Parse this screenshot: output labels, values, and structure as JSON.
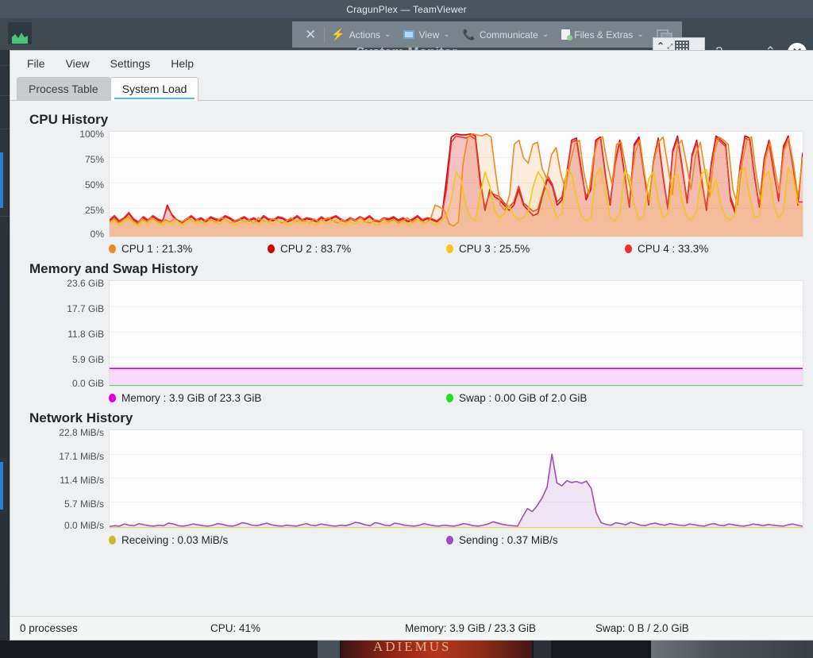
{
  "remote": {
    "title": "CragunPlex — TeamViewer",
    "app_icon": "chart-icon",
    "toolbar": {
      "close_label": "✕",
      "items": [
        {
          "label": "Actions",
          "icon": "lightning-icon",
          "caret": "⌄"
        },
        {
          "label": "View",
          "icon": "monitor-icon",
          "caret": "⌄"
        },
        {
          "label": "Communicate",
          "icon": "phone-icon",
          "caret": "⌄"
        },
        {
          "label": "Files & Extras",
          "icon": "file-icon",
          "caret": "⌄"
        }
      ],
      "windows_icon": "windows-switch-icon"
    },
    "overlay_window_title": "System Monitor",
    "popup": {
      "chevron": "⌃",
      "expand": "⤢",
      "grid": "keyboard-grid-icon"
    },
    "right_controls": [
      {
        "name": "help-button",
        "glyph": "?"
      },
      {
        "name": "minimize-button",
        "glyph": "⌄"
      },
      {
        "name": "maximize-button",
        "glyph": "⌃"
      }
    ],
    "close_glyph": "✕"
  },
  "app": {
    "menu": [
      {
        "label": "File"
      },
      {
        "label": "View"
      },
      {
        "label": "Settings"
      },
      {
        "label": "Help"
      }
    ],
    "tabs": [
      {
        "label": "Process Table",
        "active": false
      },
      {
        "label": "System Load",
        "active": true
      }
    ]
  },
  "sections": {
    "cpu": {
      "title": "CPU History",
      "y_ticks": [
        "100%",
        "75%",
        "50%",
        "25%",
        "0%"
      ],
      "legend": [
        {
          "label": "CPU 1 : 21.3%",
          "color": "#ef8a22"
        },
        {
          "label": "CPU 2 : 83.7%",
          "color": "#d40000"
        },
        {
          "label": "CPU 3 : 25.5%",
          "color": "#f5c518"
        },
        {
          "label": "CPU 4 : 33.3%",
          "color": "#e83030"
        }
      ]
    },
    "memory": {
      "title": "Memory and Swap History",
      "y_ticks": [
        "23.6 GiB",
        "17.7 GiB",
        "11.8 GiB",
        "5.9 GiB",
        "0.0 GiB"
      ],
      "legend": [
        {
          "label": "Memory : 3.9 GiB of 23.3 GiB",
          "color": "#dd00dd"
        },
        {
          "label": "Swap : 0.00 GiB of 2.0 GiB",
          "color": "#22dd22"
        }
      ]
    },
    "network": {
      "title": "Network History",
      "y_ticks": [
        "22.8 MiB/s",
        "17.1 MiB/s",
        "11.4 MiB/s",
        "5.7 MiB/s",
        "0.0 MiB/s"
      ],
      "legend": [
        {
          "label": "Receiving : 0.03 MiB/s",
          "color": "#c8b830"
        },
        {
          "label": "Sending : 0.37 MiB/s",
          "color": "#9b4fc0"
        }
      ]
    }
  },
  "statusbar": {
    "processes": "0 processes",
    "cpu": "CPU: 41%",
    "memory": "Memory: 3.9 GiB / 23.3 GiB",
    "swap": "Swap: 0 B / 2.0 GiB"
  },
  "desktop": {
    "poster_text": "ADIEMUS"
  },
  "chart_data": [
    {
      "type": "line",
      "title": "CPU History",
      "xlabel": "",
      "ylabel": "",
      "ylim": [
        0,
        100
      ],
      "ytick_values": [
        0,
        25,
        50,
        75,
        100
      ],
      "ytick_labels": [
        "0%",
        "25%",
        "50%",
        "75%",
        "100%"
      ],
      "grid": true,
      "legend_position": "below",
      "series": [
        {
          "name": "CPU 1",
          "color": "#ef8a22",
          "current": 21.3,
          "values": [
            14,
            17,
            13,
            16,
            19,
            15,
            12,
            17,
            14,
            18,
            15,
            13,
            16,
            14,
            17,
            13,
            15,
            18,
            14,
            16,
            13,
            17,
            15,
            14,
            18,
            16,
            13,
            15,
            17,
            14,
            16,
            13,
            18,
            15,
            14,
            17,
            16,
            13,
            15,
            18,
            14,
            16,
            15,
            13,
            17,
            14,
            16,
            18,
            15,
            13,
            16,
            14,
            17,
            15,
            18,
            14,
            13,
            16,
            15,
            17,
            14,
            16,
            13,
            15,
            18,
            14,
            16,
            15,
            13,
            17,
            30,
            28,
            25,
            12,
            10,
            14,
            70,
            95,
            98,
            97,
            96,
            98,
            95,
            60,
            30,
            25,
            40,
            88,
            92,
            75,
            70,
            88,
            90,
            65,
            55,
            78,
            85,
            60,
            45,
            70,
            88,
            92,
            60,
            40,
            75,
            92,
            95,
            70,
            50,
            88,
            90,
            65,
            45,
            80,
            92,
            60,
            35,
            72,
            90,
            95,
            68,
            40,
            85,
            92,
            70,
            45,
            78,
            90,
            62,
            38,
            80,
            95,
            92,
            88,
            45,
            30,
            70,
            92,
            95,
            60,
            35,
            75,
            90,
            65,
            42,
            82,
            94,
            70,
            38,
            76
          ]
        },
        {
          "name": "CPU 2",
          "color": "#d40000",
          "current": 83.7,
          "values": [
            15,
            19,
            14,
            17,
            22,
            16,
            13,
            18,
            15,
            19,
            16,
            14,
            30,
            20,
            15,
            13,
            16,
            19,
            15,
            17,
            14,
            18,
            16,
            15,
            19,
            17,
            14,
            16,
            18,
            15,
            17,
            14,
            19,
            16,
            15,
            18,
            17,
            14,
            16,
            19,
            15,
            17,
            16,
            14,
            18,
            15,
            17,
            19,
            16,
            14,
            17,
            15,
            18,
            16,
            19,
            15,
            14,
            17,
            16,
            18,
            15,
            17,
            14,
            16,
            19,
            15,
            17,
            16,
            14,
            18,
            55,
            95,
            98,
            97,
            97,
            98,
            96,
            55,
            25,
            45,
            38,
            35,
            30,
            25,
            30,
            45,
            30,
            25,
            20,
            22,
            40,
            55,
            48,
            30,
            35,
            60,
            92,
            94,
            65,
            35,
            45,
            92,
            95,
            60,
            30,
            70,
            92,
            60,
            28,
            88,
            95,
            62,
            30,
            72,
            94,
            58,
            26,
            82,
            96,
            66,
            32,
            78,
            92,
            55,
            25,
            70,
            96,
            92,
            88,
            35,
            22,
            68,
            96,
            94,
            58,
            28,
            74,
            92,
            62,
            34,
            86,
            96,
            68,
            30,
            80
          ]
        },
        {
          "name": "CPU 3",
          "color": "#f5c518",
          "current": 25.5,
          "values": [
            12,
            15,
            11,
            14,
            17,
            13,
            10,
            15,
            12,
            16,
            13,
            11,
            14,
            12,
            15,
            11,
            13,
            16,
            12,
            14,
            11,
            15,
            13,
            12,
            16,
            14,
            11,
            13,
            15,
            12,
            14,
            11,
            16,
            13,
            12,
            15,
            14,
            11,
            13,
            16,
            12,
            14,
            13,
            11,
            15,
            12,
            14,
            16,
            13,
            11,
            14,
            12,
            15,
            13,
            16,
            12,
            11,
            14,
            13,
            15,
            12,
            14,
            11,
            13,
            16,
            12,
            14,
            13,
            11,
            15,
            20,
            35,
            62,
            55,
            30,
            18,
            15,
            40,
            62,
            48,
            25,
            18,
            22,
            30,
            20,
            16,
            18,
            25,
            48,
            62,
            55,
            42,
            30,
            18,
            22,
            64,
            60,
            38,
            20,
            15,
            18,
            58,
            66,
            42,
            18,
            15,
            22,
            62,
            58,
            30,
            16,
            20,
            55,
            62,
            35,
            18,
            22,
            56,
            60,
            32,
            18,
            16,
            25,
            60,
            64,
            40,
            55,
            30,
            18,
            16,
            22,
            62,
            66,
            38,
            18,
            20,
            58,
            62,
            30,
            18,
            24,
            66,
            58,
            32,
            26
          ]
        },
        {
          "name": "CPU 4",
          "color": "#e83030",
          "current": 33.3,
          "values": [
            16,
            20,
            15,
            18,
            23,
            17,
            14,
            19,
            16,
            20,
            17,
            15,
            28,
            21,
            16,
            14,
            17,
            20,
            16,
            18,
            15,
            19,
            17,
            16,
            20,
            18,
            15,
            17,
            19,
            16,
            18,
            15,
            20,
            17,
            16,
            19,
            18,
            15,
            17,
            20,
            16,
            18,
            17,
            15,
            19,
            16,
            18,
            20,
            17,
            15,
            18,
            16,
            19,
            17,
            20,
            16,
            15,
            18,
            17,
            19,
            16,
            18,
            15,
            17,
            20,
            16,
            18,
            17,
            15,
            19,
            45,
            90,
            96,
            95,
            94,
            96,
            93,
            50,
            28,
            42,
            40,
            38,
            32,
            28,
            33,
            48,
            32,
            28,
            24,
            26,
            42,
            58,
            50,
            33,
            38,
            62,
            90,
            92,
            62,
            38,
            48,
            90,
            94,
            58,
            32,
            68,
            90,
            58,
            30,
            86,
            93,
            60,
            32,
            70,
            92,
            56,
            28,
            80,
            94,
            64,
            34,
            76,
            90,
            52,
            28,
            68,
            94,
            90,
            86,
            38,
            25,
            66,
            94,
            92,
            56,
            30,
            72,
            90,
            60,
            36,
            84,
            94,
            66,
            33,
            33
          ]
        }
      ]
    },
    {
      "type": "line",
      "title": "Memory and Swap History",
      "xlabel": "",
      "ylabel": "",
      "ylim": [
        0,
        23.6
      ],
      "ytick_values": [
        0.0,
        5.9,
        11.8,
        17.7,
        23.6
      ],
      "ytick_labels": [
        "0.0 GiB",
        "5.9 GiB",
        "11.8 GiB",
        "17.7 GiB",
        "23.6 GiB"
      ],
      "grid": true,
      "legend_position": "below",
      "series": [
        {
          "name": "Memory",
          "color": "#dd00dd",
          "current": 3.9,
          "constant": 3.9
        },
        {
          "name": "Swap",
          "color": "#22dd22",
          "current": 0.0,
          "constant": 0.0
        }
      ]
    },
    {
      "type": "line",
      "title": "Network History",
      "xlabel": "",
      "ylabel": "",
      "ylim": [
        0,
        22.8
      ],
      "ytick_values": [
        0.0,
        5.7,
        11.4,
        17.1,
        22.8
      ],
      "ytick_labels": [
        "0.0 MiB/s",
        "5.7 MiB/s",
        "11.4 MiB/s",
        "17.1 MiB/s",
        "22.8 MiB/s"
      ],
      "grid": true,
      "legend_position": "below",
      "series": [
        {
          "name": "Sending",
          "color": "#9b4fc0",
          "current": 0.37,
          "values": [
            0.3,
            0.5,
            0.4,
            0.9,
            0.6,
            0.5,
            1.0,
            0.7,
            0.5,
            0.4,
            0.6,
            0.5,
            1.1,
            0.9,
            0.5,
            0.4,
            0.6,
            0.9,
            0.7,
            0.5,
            0.4,
            0.6,
            1.0,
            0.8,
            0.5,
            0.4,
            0.7,
            1.2,
            1.0,
            0.6,
            0.5,
            0.8,
            1.1,
            0.7,
            0.5,
            0.4,
            0.6,
            0.5,
            0.4,
            0.7,
            1.0,
            0.6,
            0.5,
            0.9,
            0.7,
            0.5,
            0.4,
            0.6,
            0.5,
            0.8,
            1.3,
            1.1,
            0.7,
            0.5,
            1.2,
            1.0,
            0.6,
            0.5,
            1.1,
            0.9,
            0.6,
            0.5,
            0.4,
            0.6,
            1.0,
            0.7,
            0.5,
            0.4,
            0.6,
            0.5,
            0.4,
            0.6,
            1.0,
            0.8,
            0.5,
            0.4,
            0.6,
            0.9,
            1.4,
            1.1,
            0.8,
            0.6,
            0.5,
            0.4,
            2.5,
            4.5,
            3.8,
            5.2,
            7.0,
            9.5,
            17.2,
            10.5,
            9.8,
            11.0,
            10.6,
            10.8,
            10.4,
            10.9,
            9.2,
            3.5,
            1.2,
            0.8,
            0.6,
            1.2,
            1.0,
            0.7,
            1.3,
            1.0,
            0.6,
            0.5,
            0.9,
            1.1,
            0.8,
            0.6,
            1.0,
            0.8,
            0.6,
            0.5,
            0.9,
            0.7,
            0.5,
            0.4,
            0.8,
            1.0,
            0.6,
            0.5,
            0.9,
            0.7,
            0.5,
            0.4,
            0.6,
            0.9,
            0.7,
            0.5,
            0.8,
            0.6,
            0.5,
            0.4,
            0.7,
            0.9,
            0.6,
            0.37
          ]
        },
        {
          "name": "Receiving",
          "color": "#e8d84a",
          "current": 0.03,
          "constant": 0.03
        }
      ]
    }
  ]
}
